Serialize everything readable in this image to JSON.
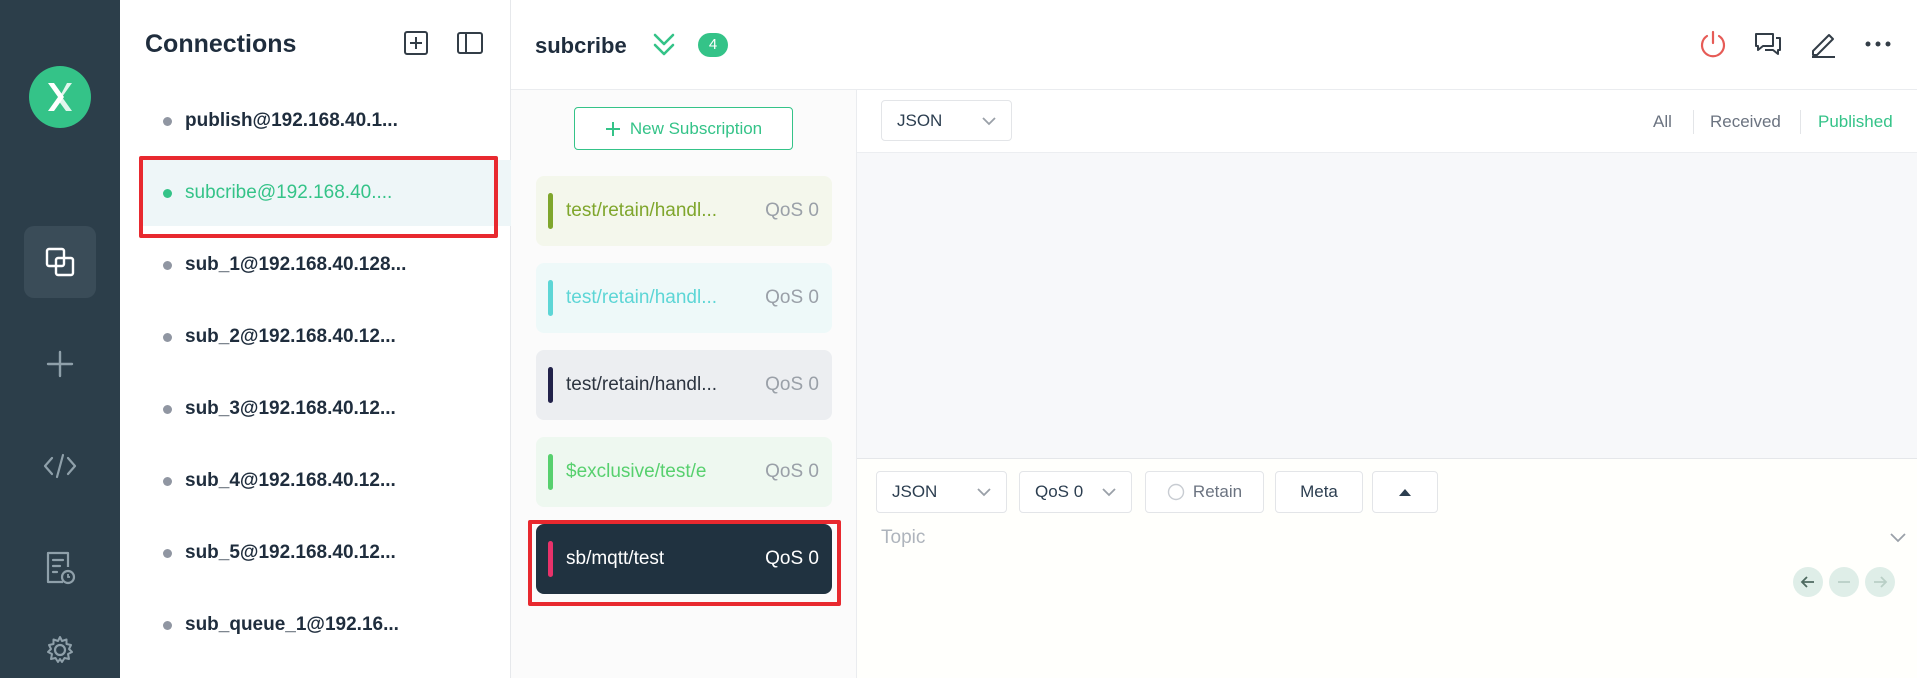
{
  "connections": {
    "title": "Connections",
    "items": [
      {
        "name": "publish@192.168.40.1...",
        "active": false
      },
      {
        "name": "subcribe@192.168.40....",
        "active": true
      },
      {
        "name": "sub_1@192.168.40.128...",
        "active": false
      },
      {
        "name": "sub_2@192.168.40.12...",
        "active": false
      },
      {
        "name": "sub_3@192.168.40.12...",
        "active": false
      },
      {
        "name": "sub_4@192.168.40.12...",
        "active": false
      },
      {
        "name": "sub_5@192.168.40.12...",
        "active": false
      },
      {
        "name": "sub_queue_1@192.16...",
        "active": false
      }
    ]
  },
  "header": {
    "title": "subcribe",
    "subscription_count": "4"
  },
  "subscriptions": {
    "new_button_label": "New Subscription",
    "items": [
      {
        "topic": "test/retain/handl...",
        "qos": "QoS 0",
        "color": "#7fa62c",
        "bg": "#f4f7ec",
        "text_color": "#7fa62c"
      },
      {
        "topic": "test/retain/handl...",
        "qos": "QoS 0",
        "color": "#5dd6d6",
        "bg": "#eef9f9",
        "text_color": "#5dd6d6"
      },
      {
        "topic": "test/retain/handl...",
        "qos": "QoS 0",
        "color": "#22224a",
        "bg": "#eceef1",
        "text_color": "#2c3440"
      },
      {
        "topic": "$exclusive/test/e",
        "qos": "QoS 0",
        "color": "#57d06e",
        "bg": "#eef8f0",
        "text_color": "#57d06e"
      },
      {
        "topic": "sb/mqtt/test",
        "qos": "QoS 0",
        "color": "#e8326a",
        "bg": "#203240",
        "text_color": "#ffffff"
      }
    ]
  },
  "messages": {
    "format": "JSON",
    "filters": [
      "All",
      "Received",
      "Published"
    ],
    "active_filter": "Published"
  },
  "publish": {
    "format": "JSON",
    "qos": "QoS 0",
    "retain_label": "Retain",
    "meta_label": "Meta",
    "topic_placeholder": "Topic"
  },
  "colors": {
    "accent": "#34c388",
    "highlight": "#e8292f",
    "rail": "#2c3e4a"
  }
}
